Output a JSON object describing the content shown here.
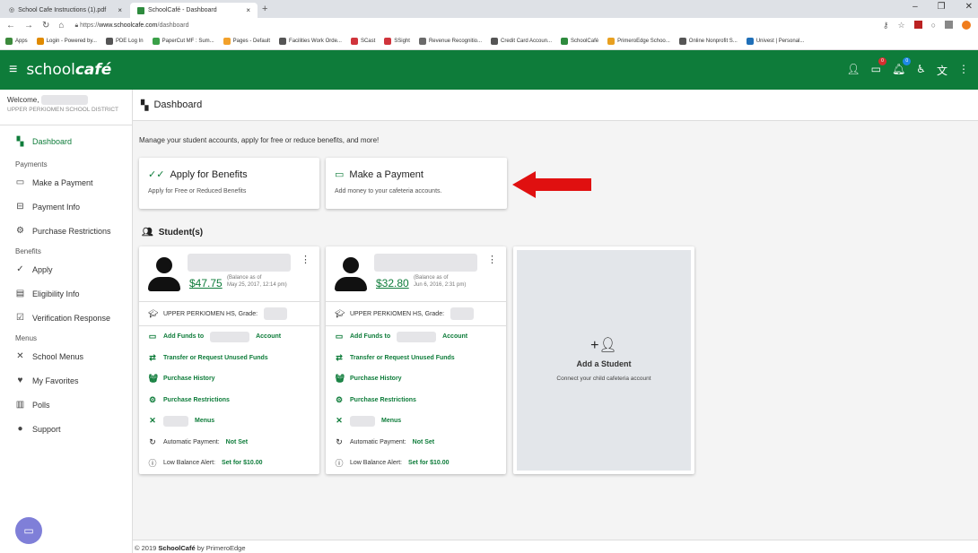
{
  "browser": {
    "tabs": [
      {
        "label": "School Cafe Instructions (1).pdf",
        "close": "×"
      },
      {
        "label": "SchoolCafé - Dashboard",
        "close": "×"
      }
    ],
    "new_tab": "+",
    "url_prefix": "https://",
    "url_host": "www.schoolcafe.com",
    "url_path": "/dashboard",
    "bookmarks": [
      {
        "label": "Apps",
        "color": "#3c8a3c"
      },
      {
        "label": "Login - Powered by...",
        "color": "#e08a00"
      },
      {
        "label": "PDE Log In",
        "color": "#555555"
      },
      {
        "label": "PaperCut MF : Sum...",
        "color": "#3aa048"
      },
      {
        "label": "Pages - Default",
        "color": "#f2a12b"
      },
      {
        "label": "Facilities Work Orde...",
        "color": "#555555"
      },
      {
        "label": "SCast",
        "color": "#d0343c"
      },
      {
        "label": "SSight",
        "color": "#d0343c"
      },
      {
        "label": "Revenue Recognitio...",
        "color": "#6a6a6a"
      },
      {
        "label": "Credit Card Accoun...",
        "color": "#555555"
      },
      {
        "label": "SchoolCafé",
        "color": "#2e8b3e"
      },
      {
        "label": "PrimeroEdge Schoo...",
        "color": "#e8a020"
      },
      {
        "label": "Online Nonprofit S...",
        "color": "#555555"
      },
      {
        "label": "Univest | Personal...",
        "color": "#1f6fb8"
      }
    ]
  },
  "app": {
    "brand_plain": "school",
    "brand_bold": "café",
    "primary_color": "#0e7c3a",
    "notifications": {
      "messages": "0",
      "alerts": "0"
    }
  },
  "sidebar": {
    "welcome": "Welcome, ",
    "district": "UPPER PERKIOMEN SCHOOL DISTRICT",
    "dashboard": "Dashboard",
    "sections": {
      "payments": "Payments",
      "benefits": "Benefits",
      "menus": "Menus"
    },
    "items": {
      "make_payment": "Make a Payment",
      "payment_info": "Payment Info",
      "purchase_restrictions": "Purchase Restrictions",
      "apply": "Apply",
      "eligibility_info": "Eligibility Info",
      "verification_response": "Verification Response",
      "school_menus": "School Menus",
      "my_favorites": "My Favorites",
      "polls": "Polls",
      "support": "Support"
    }
  },
  "main": {
    "title": "Dashboard",
    "intro": "Manage your student accounts, apply for free or reduce benefits, and more!",
    "cards": [
      {
        "title": "Apply for Benefits",
        "subtitle": "Apply for Free or Reduced Benefits"
      },
      {
        "title": "Make a Payment",
        "subtitle": "Add money to your cafeteria accounts."
      }
    ],
    "students_title": "Student(s)",
    "students": [
      {
        "balance": "$47.75",
        "balance_note_1": "(Balance as of",
        "balance_note_2": "May 25, 2017, 12:14 pm)",
        "school": "UPPER PERKIOMEN HS, Grade:",
        "add_funds_pre": "Add Funds to",
        "add_funds_post": "Account",
        "transfer": "Transfer or Request Unused Funds",
        "history": "Purchase History",
        "restrictions": "Purchase Restrictions",
        "menus": "Menus",
        "auto_label": "Automatic Payment:",
        "auto_value": "Not Set",
        "alert_label": "Low Balance Alert:",
        "alert_value": "Set for $10.00"
      },
      {
        "balance": "$32.80",
        "balance_note_1": "(Balance as of",
        "balance_note_2": "Jun 6, 2016, 2:31 pm)",
        "school": "UPPER PERKIOMEN HS, Grade:",
        "add_funds_pre": "Add Funds to",
        "add_funds_post": "Account",
        "transfer": "Transfer or Request Unused Funds",
        "history": "Purchase History",
        "restrictions": "Purchase Restrictions",
        "menus": "Menus",
        "auto_label": "Automatic Payment:",
        "auto_value": "Not Set",
        "alert_label": "Low Balance Alert:",
        "alert_value": "Set for $10.00"
      }
    ],
    "add_student": {
      "title": "Add a Student",
      "subtitle": "Connect your child cafeteria account"
    },
    "footer_pre": "© 2019 ",
    "footer_brand": "SchoolCafé",
    "footer_post": " by PrimeroEdge"
  },
  "annotation": {
    "arrow_color": "#e01010"
  }
}
